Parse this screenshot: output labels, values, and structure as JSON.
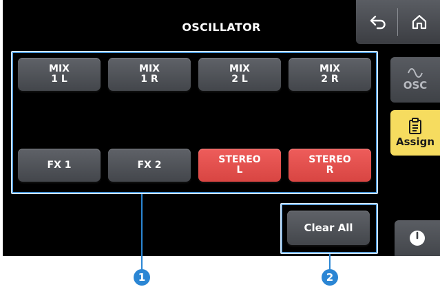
{
  "screen": {
    "title": "OSCILLATOR"
  },
  "topbar": {
    "back_icon": "undo-arrow-icon",
    "home_icon": "home-icon"
  },
  "assign_buttons": {
    "row1": [
      {
        "label": "MIX\n1 L",
        "selected": false
      },
      {
        "label": "MIX\n1 R",
        "selected": false
      },
      {
        "label": "MIX\n2 L",
        "selected": false
      },
      {
        "label": "MIX\n2 R",
        "selected": false
      }
    ],
    "row2": [
      {
        "label": "FX 1",
        "selected": false
      },
      {
        "label": "FX 2",
        "selected": false
      },
      {
        "label": "STEREO\nL",
        "selected": true
      },
      {
        "label": "STEREO\nR",
        "selected": true
      }
    ]
  },
  "sidebar": {
    "osc": {
      "label": "OSC",
      "icon": "sine-wave-icon"
    },
    "assign": {
      "label": "Assign",
      "icon": "clipboard-icon",
      "active": true
    },
    "bottom_icon": "meter-icon"
  },
  "clear_all": {
    "label": "Clear All"
  },
  "callouts": {
    "one": "1",
    "two": "2"
  },
  "colors": {
    "selected": "#e4504e",
    "button": "#505358",
    "assign_tab": "#f6dc5f",
    "callout": "#2b86d4"
  }
}
